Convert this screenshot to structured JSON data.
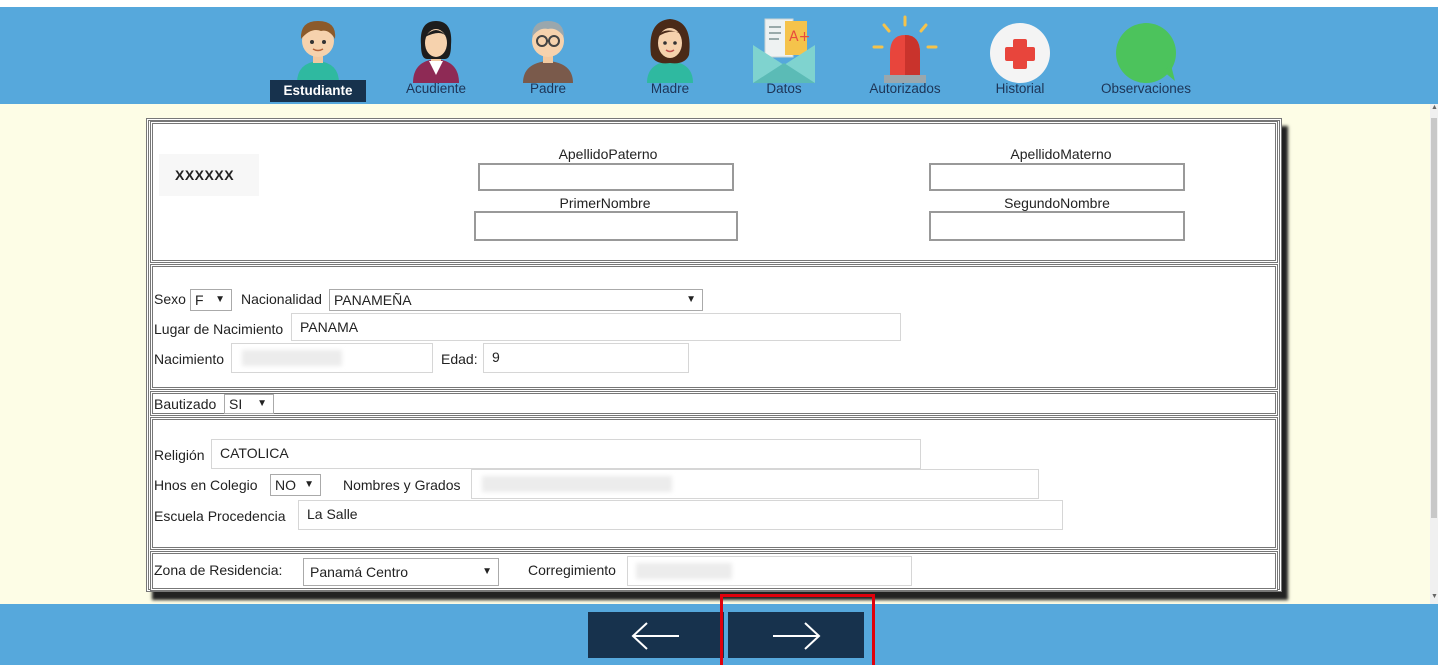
{
  "nav": {
    "items": [
      {
        "label": "Estudiante",
        "icon": "student-icon",
        "active": true
      },
      {
        "label": "Acudiente",
        "icon": "guardian-icon"
      },
      {
        "label": "Padre",
        "icon": "father-icon"
      },
      {
        "label": "Madre",
        "icon": "mother-icon"
      },
      {
        "label": "Datos",
        "icon": "document-icon"
      },
      {
        "label": "Autorizados",
        "icon": "siren-icon"
      },
      {
        "label": "Historial",
        "icon": "medical-cross-icon"
      },
      {
        "label": "Observaciones",
        "icon": "speech-bubble-icon"
      }
    ]
  },
  "header": {
    "code": "XXXXXX",
    "apellido_paterno_label": "ApellidoPaterno",
    "apellido_materno_label": "ApellidoMaterno",
    "primer_nombre_label": "PrimerNombre",
    "segundo_nombre_label": "SegundoNombre"
  },
  "personal": {
    "sexo_label": "Sexo",
    "sexo_value": "F",
    "nacionalidad_label": "Nacionalidad",
    "nacionalidad_value": "PANAMEÑA",
    "lugar_label": "Lugar de Nacimiento",
    "lugar_value": "PANAMA",
    "nacimiento_label": "Nacimiento",
    "edad_label": "Edad:",
    "edad_value": "9"
  },
  "bautizado": {
    "label": "Bautizado",
    "value": "SI"
  },
  "religion": {
    "religion_label": "Religión",
    "religion_value": "CATOLICA",
    "hnos_label": "Hnos en Colegio",
    "hnos_value": "NO",
    "nombres_label": "Nombres y Grados",
    "escuela_label": "Escuela Procedencia",
    "escuela_value": "La Salle"
  },
  "residencia": {
    "zona_label": "Zona de Residencia:",
    "zona_value": "Panamá Centro",
    "corregimiento_label": "Corregimiento"
  },
  "colors": {
    "bar_blue": "#56a8dc",
    "dark_navy": "#17324d",
    "background": "#fdfde6",
    "highlight_red": "#e0000b"
  }
}
